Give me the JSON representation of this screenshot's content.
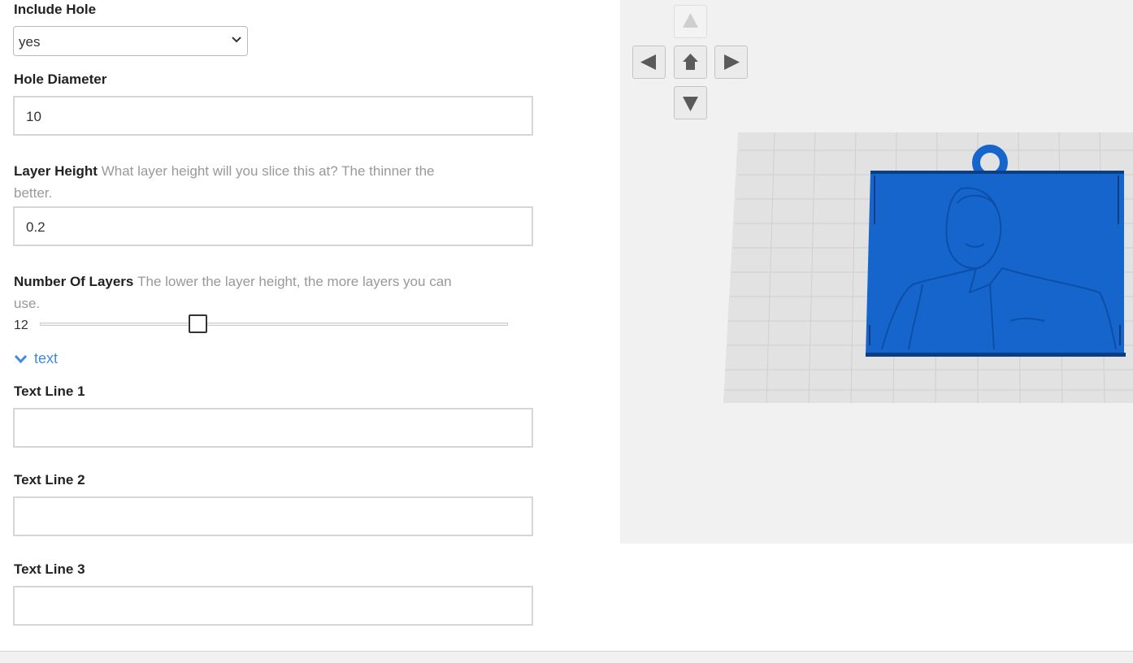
{
  "form": {
    "include_hole": {
      "label": "Include Hole",
      "value": "yes"
    },
    "hole_diameter": {
      "label": "Hole Diameter",
      "value": "10"
    },
    "layer_height": {
      "label": "Layer Height",
      "help_line1": "What layer height will you slice this at? The thinner the",
      "help_line2": "better.",
      "value": "0.2"
    },
    "number_of_layers": {
      "label": "Number Of Layers",
      "help_line1": "The lower the layer height, the more layers you can",
      "help_line2": "use.",
      "value": "12"
    },
    "text_section": {
      "label": "text"
    },
    "text_line_1": {
      "label": "Text Line 1",
      "value": ""
    },
    "text_line_2": {
      "label": "Text Line 2",
      "value": ""
    },
    "text_line_3": {
      "label": "Text Line 3",
      "value": ""
    }
  },
  "viewer": {
    "controls": [
      "arrow-up-icon",
      "arrow-left-icon",
      "home-icon",
      "arrow-right-icon",
      "arrow-down-icon"
    ],
    "model_color": "#1565cc"
  },
  "colors": {
    "link": "#3f8cde",
    "viewer_bg": "#f1f1f1"
  }
}
